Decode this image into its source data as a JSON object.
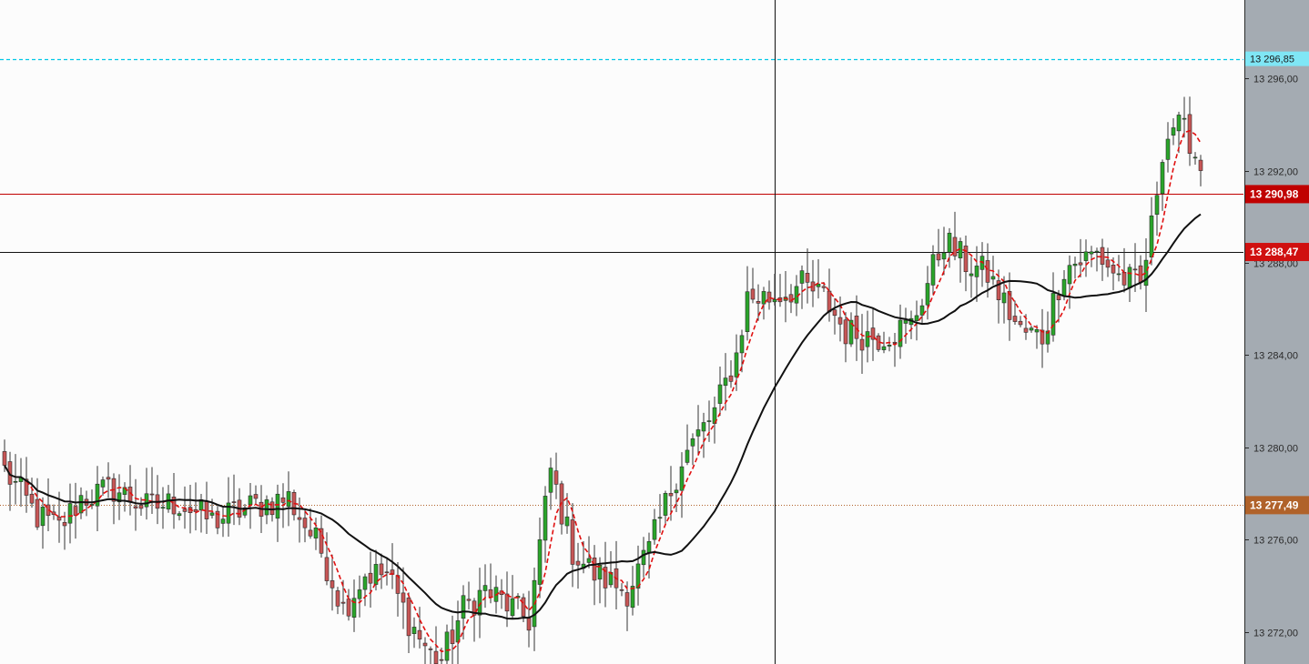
{
  "chart_data": {
    "type": "candlestick",
    "y_axis": {
      "range": [
        270.6,
        299.4
      ],
      "base": 13000,
      "ticks": [
        {
          "value": 296,
          "label": "13 296,00"
        },
        {
          "value": 292,
          "label": "13 292,00"
        },
        {
          "value": 288,
          "label": "13 288,00"
        },
        {
          "value": 284,
          "label": "13 284,00"
        },
        {
          "value": 280,
          "label": "13 280,00"
        },
        {
          "value": 276,
          "label": "13 276,00"
        },
        {
          "value": 272,
          "label": "13 272,00"
        }
      ]
    },
    "price_levels": [
      {
        "name": "upper-level",
        "value": 296.85,
        "label": "13 296,85",
        "color": "#00c8e6",
        "line": "dashed",
        "tag_text_color": "#1a1a1a"
      },
      {
        "name": "current-price",
        "value": 290.98,
        "label": "13 290,98",
        "color": "#c00000",
        "line": "solid",
        "tag_text_color": "#ffffff"
      },
      {
        "name": "crosshair-price",
        "value": 288.47,
        "label": "13 288,47",
        "color": "#d01010",
        "line": "solid-black",
        "tag_text_color": "#ffffff"
      },
      {
        "name": "lower-level",
        "value": 277.49,
        "label": "13 277,49",
        "color": "#b0622a",
        "line": "dotted",
        "tag_text_color": "#ffffff"
      }
    ],
    "crosshair_index": 141,
    "candle_anchors": [
      [
        0,
        279.0
      ],
      [
        6,
        277.0
      ],
      [
        10,
        276.5
      ],
      [
        14,
        277.8
      ],
      [
        20,
        278.2
      ],
      [
        26,
        277.4
      ],
      [
        32,
        277.6
      ],
      [
        38,
        276.8
      ],
      [
        46,
        277.5
      ],
      [
        52,
        277.8
      ],
      [
        58,
        275.5
      ],
      [
        62,
        273.0
      ],
      [
        66,
        274.5
      ],
      [
        70,
        274.5
      ],
      [
        74,
        272.5
      ],
      [
        78,
        271.0
      ],
      [
        80,
        270.8
      ],
      [
        84,
        273.0
      ],
      [
        88,
        273.8
      ],
      [
        92,
        273.2
      ],
      [
        96,
        272.5
      ],
      [
        100,
        279.0
      ],
      [
        104,
        275.5
      ],
      [
        108,
        274.5
      ],
      [
        114,
        273.8
      ],
      [
        118,
        275.5
      ],
      [
        124,
        279.5
      ],
      [
        130,
        281.5
      ],
      [
        134,
        284.0
      ],
      [
        136,
        286.5
      ],
      [
        140,
        286.5
      ],
      [
        146,
        287.0
      ],
      [
        150,
        286.5
      ],
      [
        154,
        285.0
      ],
      [
        160,
        284.8
      ],
      [
        166,
        285.3
      ],
      [
        172,
        289.0
      ],
      [
        176,
        288.0
      ],
      [
        180,
        287.5
      ],
      [
        186,
        285.0
      ],
      [
        190,
        284.8
      ],
      [
        194,
        287.8
      ],
      [
        200,
        288.4
      ],
      [
        204,
        287.4
      ],
      [
        208,
        287.0
      ],
      [
        210,
        289.5
      ],
      [
        212,
        293.0
      ],
      [
        214,
        294.0
      ],
      [
        217,
        293.4
      ],
      [
        219,
        292.0
      ]
    ],
    "series": [
      {
        "name": "MA fast",
        "color": "#e01010",
        "style": "dashed",
        "period": 5
      },
      {
        "name": "MA slow",
        "color": "#111111",
        "style": "solid",
        "period": 21
      }
    ],
    "colors": {
      "up_body": "#2aa52a",
      "down_body": "#c75656",
      "wick": "#333333",
      "background": "#fcfcfc",
      "axis_panel": "#a4abb2"
    }
  }
}
